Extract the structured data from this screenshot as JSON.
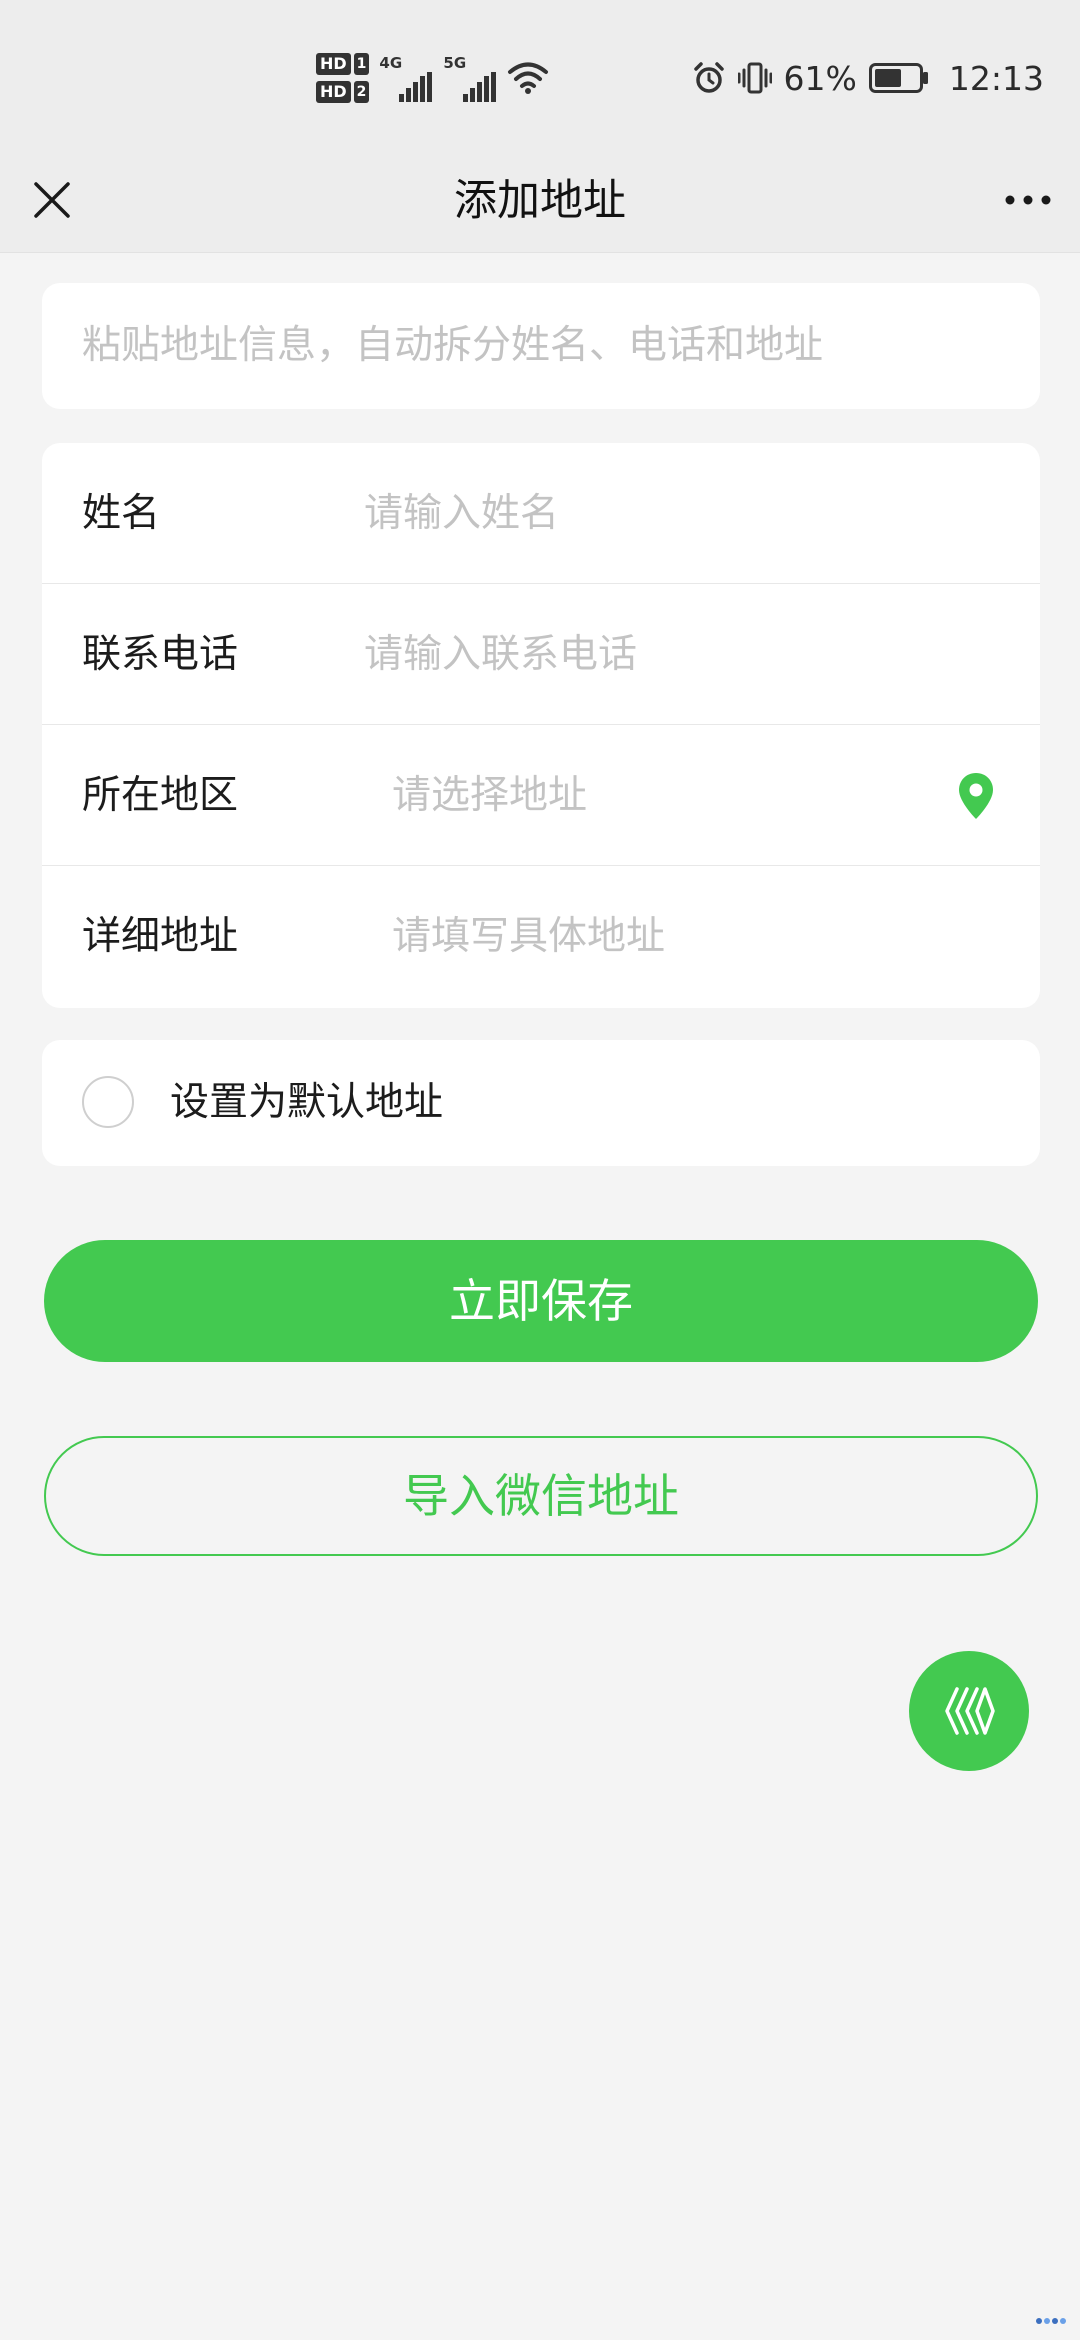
{
  "status_bar": {
    "hd1_text": "HD",
    "hd1_num": "1",
    "hd2_text": "HD",
    "hd2_num": "2",
    "sim1_network": "4G",
    "sim2_network": "5G",
    "battery_percent": "61%",
    "battery_level": 0.61,
    "time": "12:13",
    "icons": [
      "signal-icon",
      "wifi-icon",
      "alarm-icon",
      "vibrate-icon",
      "battery-icon"
    ]
  },
  "nav": {
    "title": "添加地址",
    "close_icon": "close-icon",
    "more_icon": "more-icon"
  },
  "paste": {
    "placeholder": "粘贴地址信息，自动拆分姓名、电话和地址"
  },
  "form": {
    "rows": [
      {
        "label": "姓名",
        "placeholder": "请输入姓名"
      },
      {
        "label": "联系电话",
        "placeholder": "请输入联系电话"
      },
      {
        "label": "所在地区",
        "placeholder": "请选择地址",
        "icon": "location-pin-icon"
      },
      {
        "label": "详细地址",
        "placeholder": "请填写具体地址"
      }
    ]
  },
  "default_address": {
    "label": "设置为默认地址",
    "checked": false
  },
  "buttons": {
    "save": "立即保存",
    "import": "导入微信地址"
  },
  "fab": {
    "icon": "floating-action-icon"
  },
  "colors": {
    "accent": "#43c950",
    "background": "#f4f4f4",
    "card": "#ffffff",
    "placeholder": "#c3c3c3",
    "nav_bg": "#ededed"
  }
}
